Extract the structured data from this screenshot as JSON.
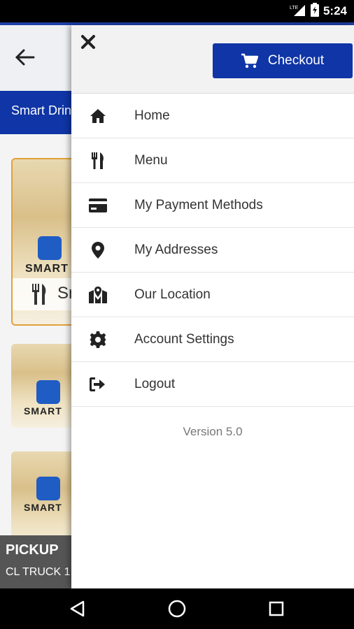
{
  "status_bar": {
    "network": "LTE",
    "time": "5:24",
    "icons": [
      "lte-signal-icon",
      "battery-icon"
    ]
  },
  "background_app": {
    "header": {
      "back_icon": "arrow-left-icon"
    },
    "subbar_title": "Smart Drinks",
    "products": [
      {
        "partial_label": "Sr",
        "icon": "fork-knife-icon",
        "logo_text": "SMART"
      },
      {
        "logo_text": "SMART"
      },
      {
        "logo_text": "SMART"
      }
    ],
    "pickup": {
      "title": "PICKUP",
      "location": "CL TRUCK 1"
    }
  },
  "drawer": {
    "close_icon": "close-icon",
    "checkout": {
      "label": "Checkout",
      "icon": "cart-icon"
    },
    "items": [
      {
        "label": "Home",
        "icon": "home-icon"
      },
      {
        "label": "Menu",
        "icon": "fork-knife-icon"
      },
      {
        "label": "My Payment Methods",
        "icon": "credit-card-icon"
      },
      {
        "label": "My Addresses",
        "icon": "map-pin-icon"
      },
      {
        "label": "Our Location",
        "icon": "map-location-icon"
      },
      {
        "label": "Account Settings",
        "icon": "gear-icon"
      },
      {
        "label": "Logout",
        "icon": "logout-icon"
      }
    ],
    "version": "Version 5.0"
  },
  "nav_bar": {
    "icons": [
      "back-triangle-icon",
      "home-circle-icon",
      "recents-square-icon"
    ]
  },
  "colors": {
    "primary_blue": "#0f35a6",
    "status_bar": "#000000",
    "drawer_bg": "#ffffff"
  }
}
